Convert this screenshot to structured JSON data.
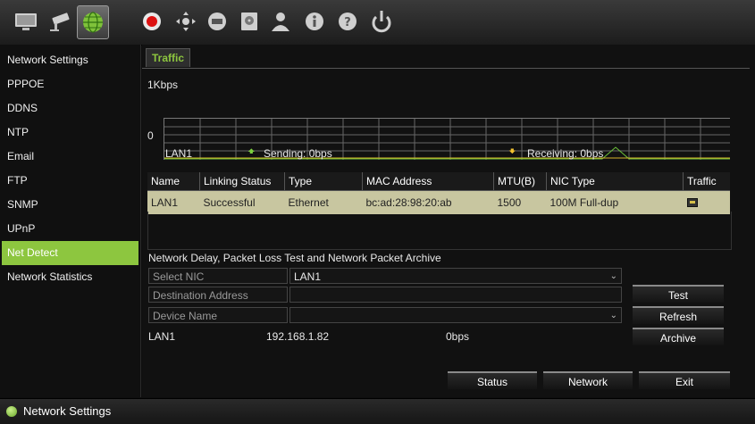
{
  "toolbar": {
    "icons": [
      "monitor-icon",
      "camera-icon",
      "network-icon",
      "record-icon",
      "ptz-icon",
      "hdd-icon",
      "archive-disk-icon",
      "user-icon",
      "info-icon",
      "help-icon",
      "power-icon"
    ],
    "active": "network-icon"
  },
  "sidebar": {
    "items": [
      {
        "label": "Network Settings"
      },
      {
        "label": "PPPOE"
      },
      {
        "label": "DDNS"
      },
      {
        "label": "NTP"
      },
      {
        "label": "Email"
      },
      {
        "label": "FTP"
      },
      {
        "label": "SNMP"
      },
      {
        "label": "UPnP"
      },
      {
        "label": "Net Detect",
        "active": true
      },
      {
        "label": "Network Statistics"
      }
    ]
  },
  "main": {
    "tab": "Traffic",
    "graph": {
      "scale_label": "1Kbps",
      "zero_label": "0",
      "nic": "LAN1",
      "sending": "Sending: 0bps",
      "receiving": "Receiving: 0bps"
    },
    "table": {
      "headers": [
        "Name",
        "Linking Status",
        "Type",
        "MAC Address",
        "MTU(B)",
        "NIC Type",
        "Traffic"
      ],
      "rows": [
        [
          "LAN1",
          "Successful",
          "Ethernet",
          "bc:ad:28:98:20:ab",
          "1500",
          "100M Full-dup"
        ]
      ]
    },
    "test": {
      "section_title": "Network Delay, Packet Loss Test and Network Packet Archive",
      "select_nic_label": "Select NIC",
      "select_nic_value": "LAN1",
      "destination_label": "Destination Address",
      "destination_value": "",
      "device_label": "Device Name",
      "device_value": "",
      "info_nic": "LAN1",
      "info_ip": "192.168.1.82",
      "info_rate": "0bps"
    },
    "buttons": {
      "test": "Test",
      "refresh": "Refresh",
      "archive": "Archive",
      "status": "Status",
      "network": "Network",
      "exit": "Exit"
    }
  },
  "statusbar": {
    "text": "Network Settings"
  },
  "colors": {
    "accent": "#8dc63f",
    "selected_row": "#c8c6a0",
    "send_arrow": "#7cd13f",
    "receive_arrow": "#f2c230"
  }
}
